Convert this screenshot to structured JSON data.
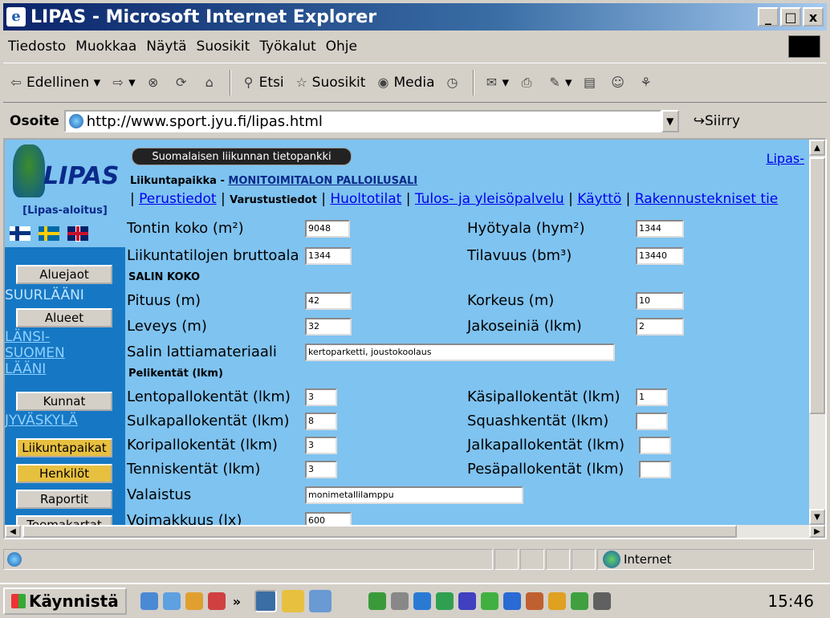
{
  "window": {
    "title": "LIPAS - Microsoft Internet Explorer",
    "minimize": "_",
    "maximize": "□",
    "close": "x"
  },
  "menu": [
    "Tiedosto",
    "Muokkaa",
    "Näytä",
    "Suosikit",
    "Työkalut",
    "Ohje"
  ],
  "toolbar": {
    "back": "Edellinen",
    "search": "Etsi",
    "favorites": "Suosikit",
    "media": "Media"
  },
  "address": {
    "label": "Osoite",
    "url": "http://www.sport.jyu.fi/lipas.html",
    "go": "Siirry"
  },
  "sidebar": {
    "logo_text": "LIPAS",
    "home_link": "[Lipas-aloitus]",
    "buttons": {
      "aluejaot": "Aluejaot",
      "alueet": "Alueet",
      "kunnat": "Kunnat",
      "liikuntapaikat": "Liikuntapaikat",
      "henkilot": "Henkilöt",
      "raportit": "Raportit",
      "teemakartat": "Teemakartat"
    },
    "suurlaani": "SUURLÄÄNI",
    "region_link": [
      "LÄNSI-",
      "SUOMEN",
      "LÄÄNI"
    ],
    "municipality_link": "JYVÄSKYLÄ"
  },
  "main": {
    "banner": "Suomalaisen liikunnan tietopankki",
    "top_link": "Lipas-",
    "facility_label": "Liikuntapaikka - ",
    "facility_name": "MONITOIMITALON PALLOILUSALI",
    "tabs": [
      "Perustiedot",
      "Varustustiedot",
      "Huoltotilat",
      "Tulos- ja yleisöpalvelu",
      "Käyttö",
      "Rakennustekniset tie"
    ],
    "fields": {
      "tontin_koko": {
        "label": "Tontin koko (m²)",
        "value": "9048"
      },
      "hyotyala": {
        "label": "Hyötyala (hym²)",
        "value": "1344"
      },
      "bruttoala": {
        "label": "Liikuntatilojen bruttoala",
        "value": "1344"
      },
      "tilavuus": {
        "label": "Tilavuus (bm³)",
        "value": "13440"
      },
      "pituus": {
        "label": "Pituus (m)",
        "value": "42"
      },
      "korkeus": {
        "label": "Korkeus (m)",
        "value": "10"
      },
      "leveys": {
        "label": "Leveys (m)",
        "value": "32"
      },
      "jakoseinia": {
        "label": "Jakoseiniä (lkm)",
        "value": "2"
      },
      "lattia": {
        "label": "Salin lattiamateriaali",
        "value": "kertoparketti, joustokoolaus"
      },
      "lentopallo": {
        "label": "Lentopallokentät (lkm)",
        "value": "3"
      },
      "kasipallo": {
        "label": "Käsipallokentät (lkm)",
        "value": "1"
      },
      "sulkapallo": {
        "label": "Sulkapallokentät (lkm)",
        "value": "8"
      },
      "squash": {
        "label": "Squashkentät (lkm)",
        "value": ""
      },
      "koripallo": {
        "label": "Koripallokentät (lkm)",
        "value": "3"
      },
      "jalkapallo": {
        "label": "Jalkapallokentät (lkm)",
        "value": ""
      },
      "tennis": {
        "label": "Tenniskentät (lkm)",
        "value": "3"
      },
      "pesapallo": {
        "label": "Pesäpallokentät (lkm)",
        "value": ""
      },
      "valaistus": {
        "label": "Valaistus",
        "value": "monimetallilamppu"
      },
      "voimakkuus": {
        "label": "Voimakkuus (lx)",
        "value": "600"
      }
    },
    "sections": {
      "salin_koko": "SALIN KOKO",
      "pelikentat": "Pelikentät (lkm)"
    }
  },
  "status": {
    "zone": "Internet"
  },
  "taskbar": {
    "start": "Käynnistä",
    "chevron": "»",
    "clock": "15:46"
  }
}
